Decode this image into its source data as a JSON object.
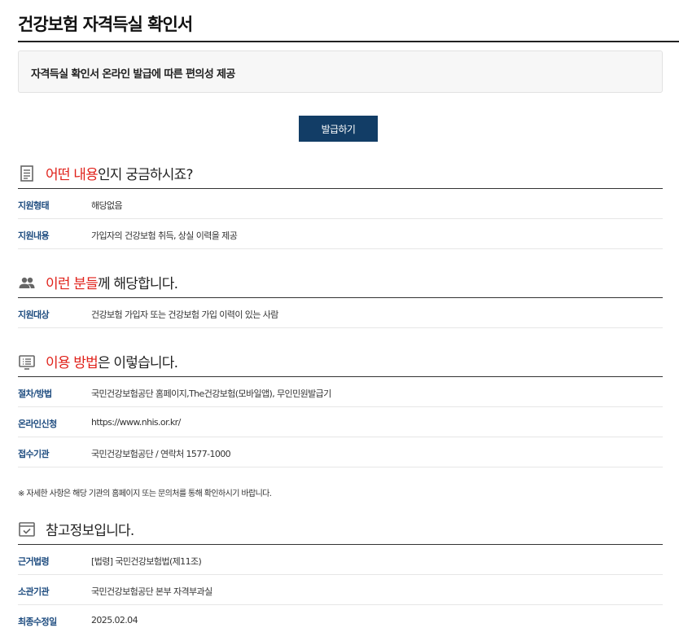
{
  "page": {
    "title": "건강보험 자격득실 확인서",
    "summary": "자격득실 확인서 온라인 발급에 따른 편의성 제공",
    "issue_button": "발급하기"
  },
  "sections": {
    "content": {
      "icon": "document-icon",
      "title_highlight": "어떤 내용",
      "title_rest": "인지 궁금하시죠?",
      "rows": [
        {
          "label": "지원형태",
          "value": "해당없음"
        },
        {
          "label": "지원내용",
          "value": "가입자의 건강보험 취득, 상실 이력을 제공"
        }
      ]
    },
    "target": {
      "icon": "people-icon",
      "title_highlight": "이런 분들",
      "title_rest": "께 해당합니다.",
      "rows": [
        {
          "label": "지원대상",
          "value": "건강보험 가입자 또는 건강보험 가입 이력이 있는 사람"
        }
      ]
    },
    "method": {
      "icon": "monitor-list-icon",
      "title_highlight": "이용 방법",
      "title_rest": "은 이렇습니다.",
      "rows": [
        {
          "label": "절차/방법",
          "value": "국민건강보험공단 홈페이지,The건강보험(모바일앱), 무인민원발급기"
        },
        {
          "label": "온라인신청",
          "value": "https://www.nhis.or.kr/"
        },
        {
          "label": "접수기관",
          "value": "국민건강보험공단 / 연락처 1577-1000"
        }
      ],
      "note": "※ 자세한 사항은 해당 기관의 홈페이지 또는 문의처를 통해 확인하시기 바랍니다."
    },
    "reference": {
      "icon": "checkbox-window-icon",
      "title": "참고정보입니다.",
      "rows": [
        {
          "label": "근거법령",
          "value": "[법령] 국민건강보험법(제11조)"
        },
        {
          "label": "소관기관",
          "value": "국민건강보험공단 본부 자격부과실"
        },
        {
          "label": "최종수정일",
          "value": "2025.02.04"
        }
      ]
    }
  },
  "colors": {
    "accent_red": "#e0221b",
    "label_blue": "#1f4d80",
    "button_navy": "#123d66"
  }
}
